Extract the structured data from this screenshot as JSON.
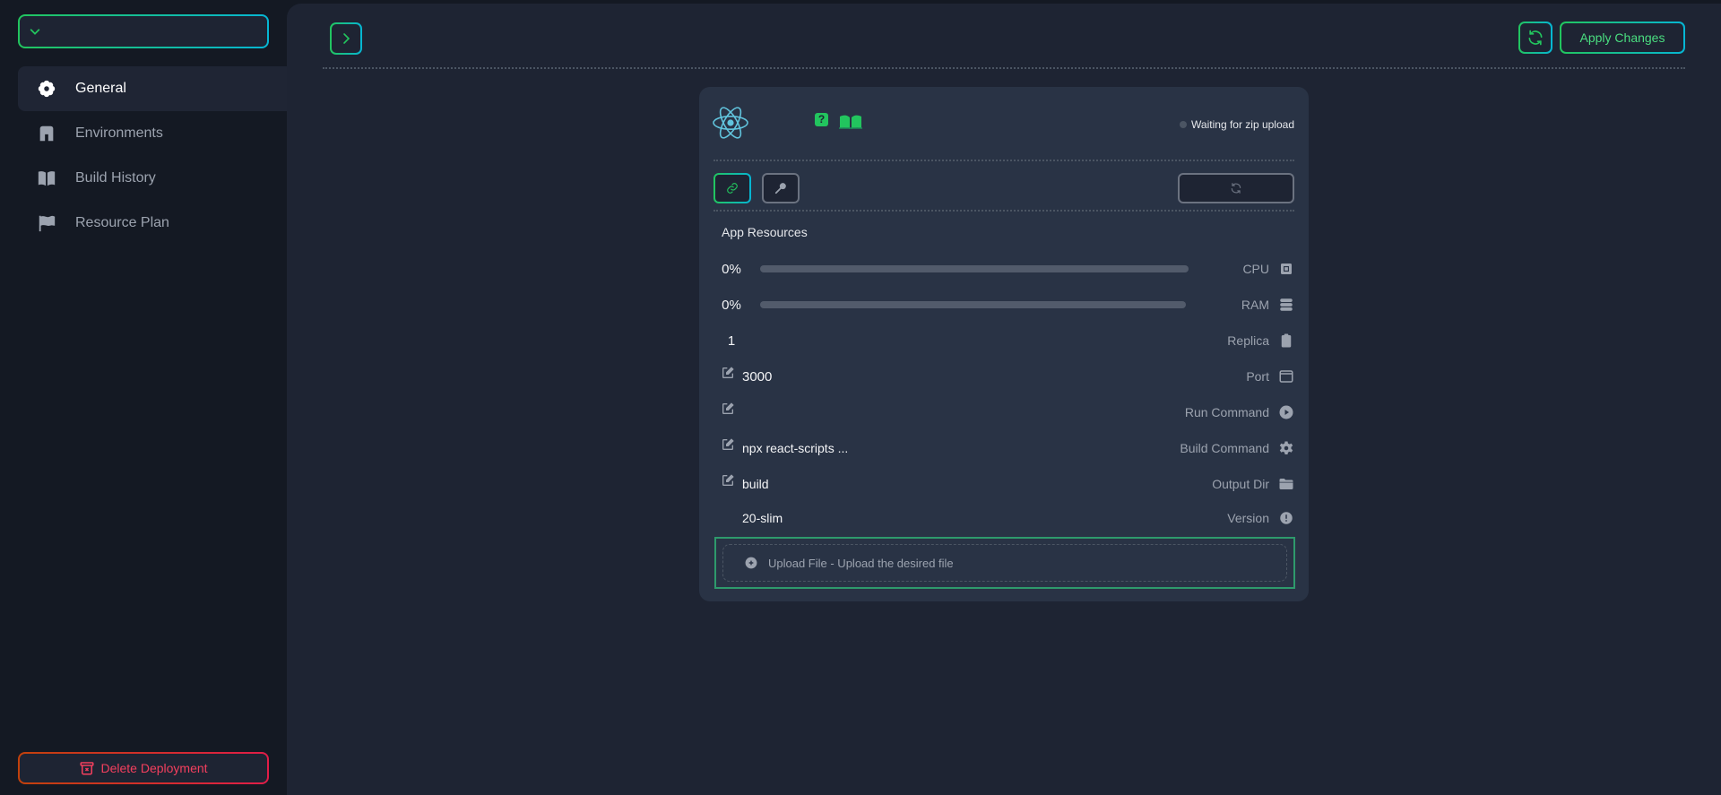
{
  "sidebar": {
    "env_select": {
      "value": "",
      "icon": "chevron-down-icon"
    },
    "items": [
      {
        "label": "General",
        "icon": "gear-flower-icon",
        "active": true
      },
      {
        "label": "Environments",
        "icon": "archway-icon",
        "active": false
      },
      {
        "label": "Build History",
        "icon": "book-icon",
        "active": false
      },
      {
        "label": "Resource Plan",
        "icon": "flag-icon",
        "active": false
      }
    ],
    "delete_label": "Delete Deployment"
  },
  "toolbar": {
    "apply_label": "Apply Changes"
  },
  "card": {
    "status": "Waiting for zip upload",
    "help_glyph": "?",
    "resources_title": "App Resources",
    "cpu": {
      "value": "0%",
      "label": "CPU",
      "fraction": 0
    },
    "ram": {
      "value": "0%",
      "label": "RAM",
      "fraction": 0
    },
    "replica": {
      "value": "1",
      "label": "Replica"
    },
    "port": {
      "value": "3000",
      "label": "Port"
    },
    "run_command": {
      "value": "",
      "label": "Run Command"
    },
    "build_command": {
      "value": "npx react-scripts ...",
      "label": "Build Command"
    },
    "output_dir": {
      "value": "build",
      "label": "Output Dir"
    },
    "version": {
      "value": "20-slim",
      "label": "Version"
    },
    "upload_text": "Upload File - Upload the desired file"
  },
  "colors": {
    "accent_green": "#22c55e",
    "accent_cyan": "#06b6d4",
    "danger": "#f43f5e",
    "card_bg": "#293345",
    "main_bg": "#1e2433",
    "sidebar_bg": "#141923"
  }
}
